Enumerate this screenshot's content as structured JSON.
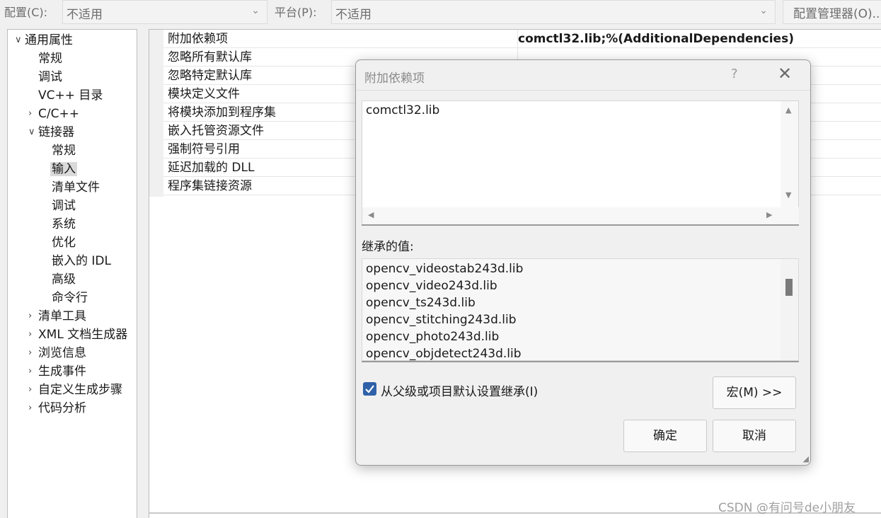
{
  "topbar": {
    "config_label": "配置(C):",
    "config_value": "不适用",
    "platform_label": "平台(P):",
    "platform_value": "不适用",
    "config_manager_button": "配置管理器(O)..."
  },
  "tree": {
    "items": [
      {
        "label": "通用属性",
        "expand": "v"
      },
      {
        "label": "常规"
      },
      {
        "label": "调试"
      },
      {
        "label": "VC++ 目录"
      },
      {
        "label": "C/C++",
        "expand": ">"
      },
      {
        "label": "链接器",
        "expand": "v"
      },
      {
        "label": "常规"
      },
      {
        "label": "输入"
      },
      {
        "label": "清单文件"
      },
      {
        "label": "调试"
      },
      {
        "label": "系统"
      },
      {
        "label": "优化"
      },
      {
        "label": "嵌入的 IDL"
      },
      {
        "label": "高级"
      },
      {
        "label": "命令行"
      },
      {
        "label": "清单工具",
        "expand": ">"
      },
      {
        "label": "XML 文档生成器",
        "expand": ">"
      },
      {
        "label": "浏览信息",
        "expand": ">"
      },
      {
        "label": "生成事件",
        "expand": ">"
      },
      {
        "label": "自定义生成步骤",
        "expand": ">"
      },
      {
        "label": "代码分析",
        "expand": ">"
      }
    ]
  },
  "grid": {
    "rows": [
      {
        "name": "附加依赖项",
        "value": "comctl32.lib;%(AdditionalDependencies)"
      },
      {
        "name": "忽略所有默认库",
        "value": ""
      },
      {
        "name": "忽略特定默认库",
        "value": ""
      },
      {
        "name": "模块定义文件",
        "value": ""
      },
      {
        "name": "将模块添加到程序集",
        "value": ""
      },
      {
        "name": "嵌入托管资源文件",
        "value": ""
      },
      {
        "name": "强制符号引用",
        "value": ""
      },
      {
        "name": "延迟加载的 DLL",
        "value": ""
      },
      {
        "name": "程序集链接资源",
        "value": ""
      }
    ]
  },
  "dialog": {
    "title": "附加依赖项",
    "help": "?",
    "close": "✕",
    "edit_text": "comctl32.lib",
    "inherited_label": "继承的值:",
    "inherited_values": [
      "opencv_videostab243d.lib",
      "opencv_video243d.lib",
      "opencv_ts243d.lib",
      "opencv_stitching243d.lib",
      "opencv_photo243d.lib",
      "opencv_objdetect243d.lib"
    ],
    "inherit_checkbox_label": "从父级或项目默认设置继承(I)",
    "inherit_checked": true,
    "macro_button": "宏(M) >>",
    "ok_button": "确定",
    "cancel_button": "取消"
  },
  "watermark": "CSDN @有问号de小朋友",
  "colors": {
    "accent": "#2f61a8",
    "selected_bg": "#dadada"
  }
}
